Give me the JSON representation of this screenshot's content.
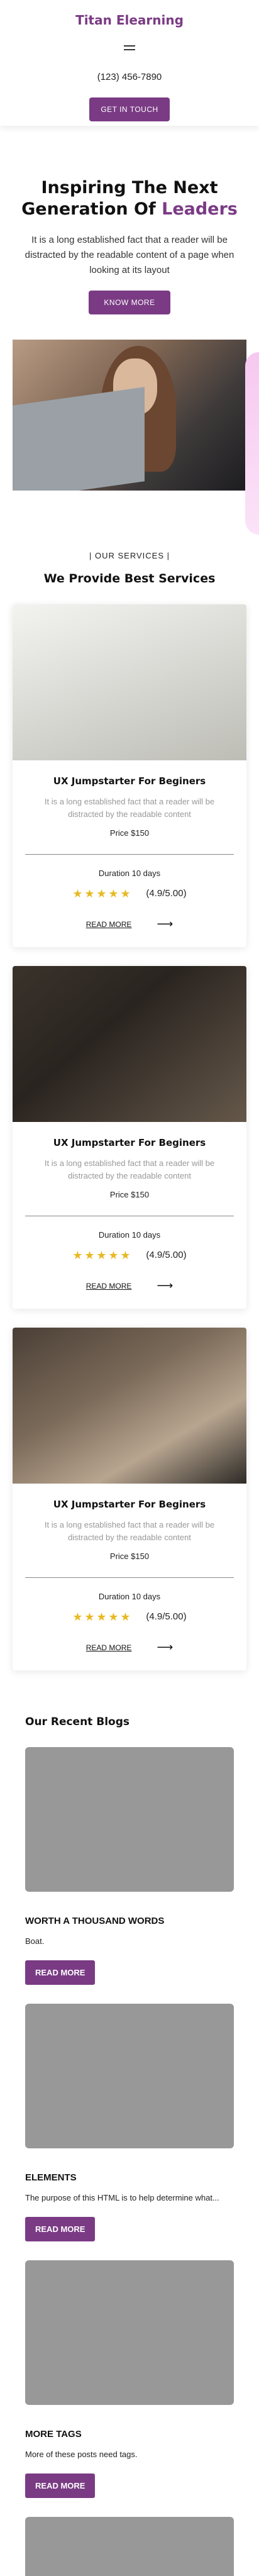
{
  "header": {
    "brand": "Titan Elearning",
    "phone": "(123) 456-7890",
    "cta": "GET IN TOUCH"
  },
  "hero": {
    "title_line1": "Inspiring The Next",
    "title_line2_plain": "Generation Of ",
    "title_line2_accent": "Leaders",
    "text": "It is a long established fact that a reader will be distracted by the readable content of a page when looking at its layout",
    "button": "KNOW MORE"
  },
  "services": {
    "tag": "|  OUR SERVICES  |",
    "title": "We Provide Best Services",
    "cards": [
      {
        "title": "UX Jumpstarter For Beginers",
        "text": "It is a long established fact that a reader will be distracted by the readable content",
        "price": "Price $150",
        "duration": "Duration 10 days",
        "rating": "(4.9/5.00)",
        "read_more": "READ MORE"
      },
      {
        "title": "UX Jumpstarter For Beginers",
        "text": "It is a long established fact that a reader will be distracted by the readable content",
        "price": "Price $150",
        "duration": "Duration 10 days",
        "rating": "(4.9/5.00)",
        "read_more": "READ MORE"
      },
      {
        "title": "UX Jumpstarter For Beginers",
        "text": "It is a long established fact that a reader will be distracted by the readable content",
        "price": "Price $150",
        "duration": "Duration 10 days",
        "rating": "(4.9/5.00)",
        "read_more": "READ MORE"
      }
    ]
  },
  "blogs": {
    "title": "Our Recent Blogs",
    "items": [
      {
        "title": "WORTH A THOUSAND WORDS",
        "text": "Boat.",
        "button": "READ MORE"
      },
      {
        "title": "ELEMENTS",
        "text": "The purpose of this HTML is to help determine what...",
        "button": "READ MORE"
      },
      {
        "title": "MORE TAGS",
        "text": "More of these posts need tags.",
        "button": "READ MORE"
      }
    ]
  },
  "colors": {
    "brand": "#7a3b84",
    "star": "#e8b923",
    "image_placeholder": "#989898"
  }
}
